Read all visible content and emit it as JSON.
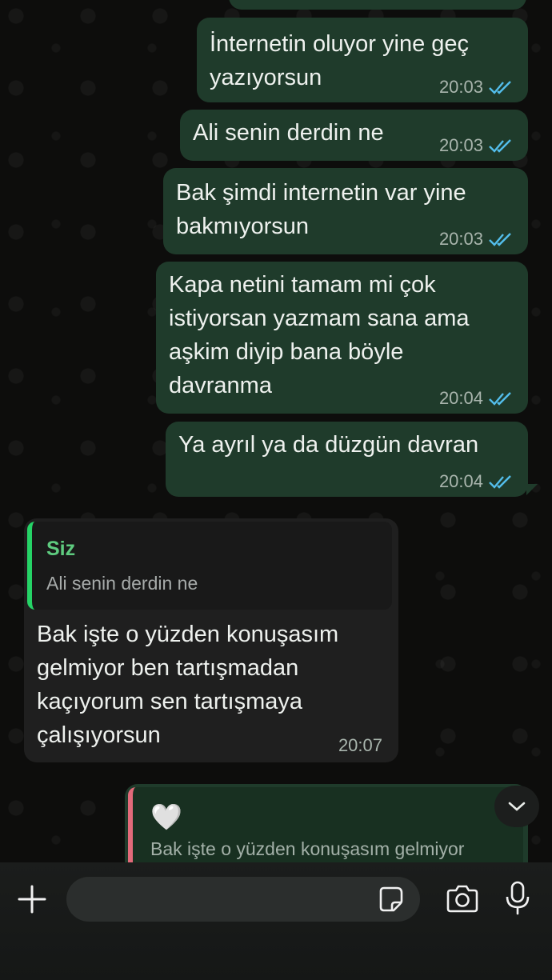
{
  "conversation": {
    "outgoing": [
      {
        "text": "İnternetin oluyor yine geç\nyazıyorsun",
        "time": "20:03"
      },
      {
        "text": "Ali senin derdin ne",
        "time": "20:03"
      },
      {
        "text": "Bak şimdi internetin var yine\nbakmıyorsun",
        "time": "20:03"
      },
      {
        "text": "Kapa netini tamam mi çok\nistiyorsan yazmam sana ama\naşkim diyip bana böyle\ndavranma",
        "time": "20:04"
      },
      {
        "text": "Ya ayrıl ya da düzgün davran",
        "time": "20:04"
      }
    ],
    "incoming_reply": {
      "quoted_author": "Siz",
      "quoted_text": "Ali senin derdin ne",
      "text": "Bak işte o yüzden konuşasım\ngelmiyor ben tartışmadan\nkaçıyorum sen tartışmaya\nçalışıyorsun",
      "time": "20:07"
    },
    "outgoing_reaction_reply": {
      "emoji": "🤍",
      "quoted_text": "Bak işte o yüzden konuşasım gelmiyor"
    }
  },
  "colors": {
    "outgoing_bubble": "#1f3b2b",
    "incoming_bubble": "#1f1f1f",
    "read_ticks": "#53bdeb",
    "quote_bar_green": "#25d366",
    "quote_bar_pink": "#e26a7a"
  },
  "icons": {
    "attach": "plus-icon",
    "sticker": "sticker-icon",
    "camera": "camera-icon",
    "mic": "microphone-icon",
    "scroll": "chevron-down-icon",
    "read_receipt": "double-check-icon"
  }
}
